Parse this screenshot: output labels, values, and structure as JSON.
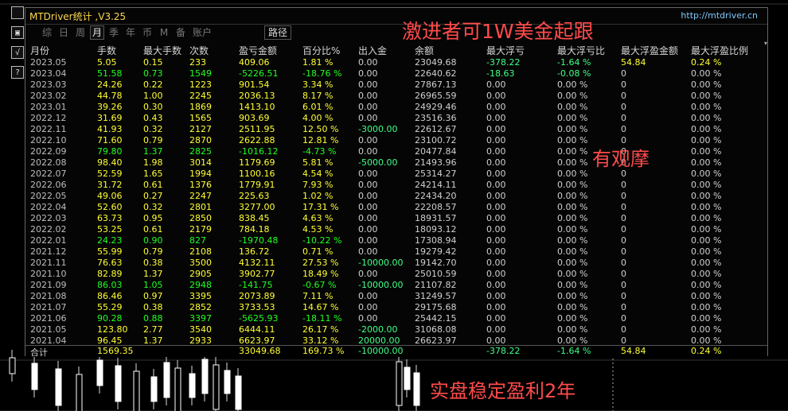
{
  "window": {
    "title": "MTDriver统计 ,V3.25",
    "url": "http://mtdriver.cn"
  },
  "side_tools": [
    {
      "label": "",
      "name": "toolbar-toggle-icon"
    },
    {
      "label": "▣",
      "name": "screen-icon"
    },
    {
      "label": "√",
      "name": "check-icon"
    },
    {
      "label": "?",
      "name": "help-icon"
    }
  ],
  "tabs": [
    {
      "label": "综"
    },
    {
      "label": "日"
    },
    {
      "label": "周"
    },
    {
      "label": "月"
    },
    {
      "label": "季"
    },
    {
      "label": "年"
    },
    {
      "label": "币"
    },
    {
      "label": "M"
    },
    {
      "label": "备"
    },
    {
      "label": "账户"
    }
  ],
  "path_button": "路径",
  "sort_icon": "▾",
  "table": {
    "headers": [
      "月份",
      "手数",
      "最大手数",
      "次数",
      "盈亏金额",
      "百分比%",
      "出入金",
      "余额",
      "最大浮亏",
      "最大浮亏比",
      "最大浮盈金额",
      "最大浮盈比例"
    ],
    "rows": [
      {
        "month": "2023.05",
        "lots": "5.05",
        "max_lots": "0.15",
        "count": "233",
        "pnl": "409.06",
        "pct": "1.81 %",
        "deposit": "0.00",
        "balance": "23049.68",
        "max_dd": "-378.22",
        "max_dd_pct": "-1.64 %",
        "max_fp": "54.84",
        "max_fp_pct": "0.24 %",
        "loss": false
      },
      {
        "month": "2023.04",
        "lots": "51.58",
        "max_lots": "0.73",
        "count": "1549",
        "pnl": "-5226.51",
        "pct": "-18.76 %",
        "deposit": "0.00",
        "balance": "22640.62",
        "max_dd": "-18.63",
        "max_dd_pct": "-0.08 %",
        "max_fp": "0",
        "max_fp_pct": "0.00 %",
        "loss": true
      },
      {
        "month": "2023.03",
        "lots": "24.26",
        "max_lots": "0.22",
        "count": "1223",
        "pnl": "901.54",
        "pct": "3.34 %",
        "deposit": "0.00",
        "balance": "27867.13",
        "max_dd": "0.00",
        "max_dd_pct": "0.00 %",
        "max_fp": "0",
        "max_fp_pct": "0.00 %",
        "loss": false
      },
      {
        "month": "2023.02",
        "lots": "44.78",
        "max_lots": "1.00",
        "count": "2245",
        "pnl": "2036.13",
        "pct": "8.17 %",
        "deposit": "0.00",
        "balance": "26965.59",
        "max_dd": "0.00",
        "max_dd_pct": "0.00 %",
        "max_fp": "0",
        "max_fp_pct": "0.00 %",
        "loss": false
      },
      {
        "month": "2023.01",
        "lots": "39.26",
        "max_lots": "0.30",
        "count": "1869",
        "pnl": "1413.10",
        "pct": "6.01 %",
        "deposit": "0.00",
        "balance": "24929.46",
        "max_dd": "0.00",
        "max_dd_pct": "0.00 %",
        "max_fp": "0",
        "max_fp_pct": "0.00 %",
        "loss": false
      },
      {
        "month": "2022.12",
        "lots": "31.69",
        "max_lots": "0.43",
        "count": "1565",
        "pnl": "903.69",
        "pct": "4.00 %",
        "deposit": "0.00",
        "balance": "23516.36",
        "max_dd": "0.00",
        "max_dd_pct": "0.00 %",
        "max_fp": "0",
        "max_fp_pct": "0.00 %",
        "loss": false
      },
      {
        "month": "2022.11",
        "lots": "41.93",
        "max_lots": "0.32",
        "count": "2127",
        "pnl": "2511.95",
        "pct": "12.50 %",
        "deposit": "-3000.00",
        "balance": "22612.67",
        "max_dd": "0.00",
        "max_dd_pct": "0.00 %",
        "max_fp": "0",
        "max_fp_pct": "0.00 %",
        "loss": false
      },
      {
        "month": "2022.10",
        "lots": "71.60",
        "max_lots": "0.79",
        "count": "2870",
        "pnl": "2622.88",
        "pct": "12.81 %",
        "deposit": "0.00",
        "balance": "23100.72",
        "max_dd": "0.00",
        "max_dd_pct": "0.00 %",
        "max_fp": "0",
        "max_fp_pct": "0.00 %",
        "loss": false
      },
      {
        "month": "2022.09",
        "lots": "79.80",
        "max_lots": "1.37",
        "count": "2825",
        "pnl": "-1016.12",
        "pct": "-4.73 %",
        "deposit": "0.00",
        "balance": "20477.84",
        "max_dd": "0.00",
        "max_dd_pct": "0.00 %",
        "max_fp": "0",
        "max_fp_pct": "0.00 %",
        "loss": true
      },
      {
        "month": "2022.08",
        "lots": "98.40",
        "max_lots": "1.98",
        "count": "3014",
        "pnl": "1179.69",
        "pct": "5.81 %",
        "deposit": "-5000.00",
        "balance": "21493.96",
        "max_dd": "0.00",
        "max_dd_pct": "0.00 %",
        "max_fp": "0",
        "max_fp_pct": "0.00 %",
        "loss": false
      },
      {
        "month": "2022.07",
        "lots": "52.59",
        "max_lots": "1.65",
        "count": "1994",
        "pnl": "1100.16",
        "pct": "4.54 %",
        "deposit": "0.00",
        "balance": "25314.27",
        "max_dd": "0.00",
        "max_dd_pct": "0.00 %",
        "max_fp": "0",
        "max_fp_pct": "0.00 %",
        "loss": false
      },
      {
        "month": "2022.06",
        "lots": "31.72",
        "max_lots": "0.61",
        "count": "1376",
        "pnl": "1779.91",
        "pct": "7.93 %",
        "deposit": "0.00",
        "balance": "24214.11",
        "max_dd": "0.00",
        "max_dd_pct": "0.00 %",
        "max_fp": "0",
        "max_fp_pct": "0.00 %",
        "loss": false
      },
      {
        "month": "2022.05",
        "lots": "49.06",
        "max_lots": "0.27",
        "count": "2247",
        "pnl": "225.63",
        "pct": "1.02 %",
        "deposit": "0.00",
        "balance": "22434.20",
        "max_dd": "0.00",
        "max_dd_pct": "0.00 %",
        "max_fp": "0",
        "max_fp_pct": "0.00 %",
        "loss": false
      },
      {
        "month": "2022.04",
        "lots": "52.60",
        "max_lots": "0.32",
        "count": "2801",
        "pnl": "3277.00",
        "pct": "17.31 %",
        "deposit": "0.00",
        "balance": "22208.57",
        "max_dd": "0.00",
        "max_dd_pct": "0.00 %",
        "max_fp": "0",
        "max_fp_pct": "0.00 %",
        "loss": false
      },
      {
        "month": "2022.03",
        "lots": "63.73",
        "max_lots": "0.95",
        "count": "2850",
        "pnl": "838.45",
        "pct": "4.63 %",
        "deposit": "0.00",
        "balance": "18931.57",
        "max_dd": "0.00",
        "max_dd_pct": "0.00 %",
        "max_fp": "0",
        "max_fp_pct": "0.00 %",
        "loss": false
      },
      {
        "month": "2022.02",
        "lots": "53.25",
        "max_lots": "0.61",
        "count": "2179",
        "pnl": "784.18",
        "pct": "4.53 %",
        "deposit": "0.00",
        "balance": "18093.12",
        "max_dd": "0.00",
        "max_dd_pct": "0.00 %",
        "max_fp": "0",
        "max_fp_pct": "0.00 %",
        "loss": false
      },
      {
        "month": "2022.01",
        "lots": "24.23",
        "max_lots": "0.90",
        "count": "827",
        "pnl": "-1970.48",
        "pct": "-10.22 %",
        "deposit": "0.00",
        "balance": "17308.94",
        "max_dd": "0.00",
        "max_dd_pct": "0.00 %",
        "max_fp": "0",
        "max_fp_pct": "0.00 %",
        "loss": true
      },
      {
        "month": "2021.12",
        "lots": "55.99",
        "max_lots": "0.79",
        "count": "2108",
        "pnl": "136.72",
        "pct": "0.71 %",
        "deposit": "0.00",
        "balance": "19279.42",
        "max_dd": "0.00",
        "max_dd_pct": "0.00 %",
        "max_fp": "0",
        "max_fp_pct": "0.00 %",
        "loss": false
      },
      {
        "month": "2021.11",
        "lots": "76.63",
        "max_lots": "0.38",
        "count": "3500",
        "pnl": "4132.11",
        "pct": "27.53 %",
        "deposit": "-10000.00",
        "balance": "19142.70",
        "max_dd": "0.00",
        "max_dd_pct": "0.00 %",
        "max_fp": "0",
        "max_fp_pct": "0.00 %",
        "loss": false
      },
      {
        "month": "2021.10",
        "lots": "82.89",
        "max_lots": "1.37",
        "count": "2905",
        "pnl": "3902.77",
        "pct": "18.49 %",
        "deposit": "0.00",
        "balance": "25010.59",
        "max_dd": "0.00",
        "max_dd_pct": "0.00 %",
        "max_fp": "0",
        "max_fp_pct": "0.00 %",
        "loss": false
      },
      {
        "month": "2021.09",
        "lots": "86.03",
        "max_lots": "1.05",
        "count": "2948",
        "pnl": "-141.75",
        "pct": "-0.67 %",
        "deposit": "-10000.00",
        "balance": "21107.82",
        "max_dd": "0.00",
        "max_dd_pct": "0.00 %",
        "max_fp": "0",
        "max_fp_pct": "0.00 %",
        "loss": true
      },
      {
        "month": "2021.08",
        "lots": "86.46",
        "max_lots": "0.97",
        "count": "3395",
        "pnl": "2073.89",
        "pct": "7.11 %",
        "deposit": "0.00",
        "balance": "31249.57",
        "max_dd": "0.00",
        "max_dd_pct": "0.00 %",
        "max_fp": "0",
        "max_fp_pct": "0.00 %",
        "loss": false
      },
      {
        "month": "2021.07",
        "lots": "55.29",
        "max_lots": "0.38",
        "count": "2852",
        "pnl": "3733.53",
        "pct": "14.67 %",
        "deposit": "0.00",
        "balance": "29175.68",
        "max_dd": "0.00",
        "max_dd_pct": "0.00 %",
        "max_fp": "0",
        "max_fp_pct": "0.00 %",
        "loss": false
      },
      {
        "month": "2021.06",
        "lots": "90.28",
        "max_lots": "0.88",
        "count": "3397",
        "pnl": "-5625.93",
        "pct": "-18.11 %",
        "deposit": "0.00",
        "balance": "25442.15",
        "max_dd": "0.00",
        "max_dd_pct": "0.00 %",
        "max_fp": "0",
        "max_fp_pct": "0.00 %",
        "loss": true
      },
      {
        "month": "2021.05",
        "lots": "123.80",
        "max_lots": "2.77",
        "count": "3540",
        "pnl": "6444.11",
        "pct": "26.17 %",
        "deposit": "-2000.00",
        "balance": "31068.08",
        "max_dd": "0.00",
        "max_dd_pct": "0.00 %",
        "max_fp": "0",
        "max_fp_pct": "0.00 %",
        "loss": false
      },
      {
        "month": "2021.04",
        "lots": "96.45",
        "max_lots": "1.37",
        "count": "2933",
        "pnl": "6623.97",
        "pct": "33.12 %",
        "deposit": "20000.00",
        "balance": "26623.97",
        "max_dd": "0.00",
        "max_dd_pct": "0.00 %",
        "max_fp": "0",
        "max_fp_pct": "0.00 %",
        "loss": false
      }
    ],
    "total": {
      "label": "合计",
      "lots": "1569.35",
      "pnl": "33049.68",
      "pct": "169.73 %",
      "deposit": "-10000.00",
      "max_dd": "-378.22",
      "max_dd_pct": "-1.64 %",
      "max_fp": "54.84",
      "max_fp_pct": "0.24 %"
    }
  },
  "overlays": [
    {
      "text": "激进者可1W美金起跟",
      "name": "overlay-aggressive-follow"
    },
    {
      "text": "有观摩",
      "name": "overlay-watch"
    },
    {
      "text": "实盘稳定盈利2年",
      "name": "overlay-stable-profit"
    }
  ],
  "colors": {
    "profit": "#ffff33",
    "loss": "#20ff20",
    "accent": "#ff4b4b",
    "title": "#ffd84d",
    "url": "#7ecbff"
  }
}
